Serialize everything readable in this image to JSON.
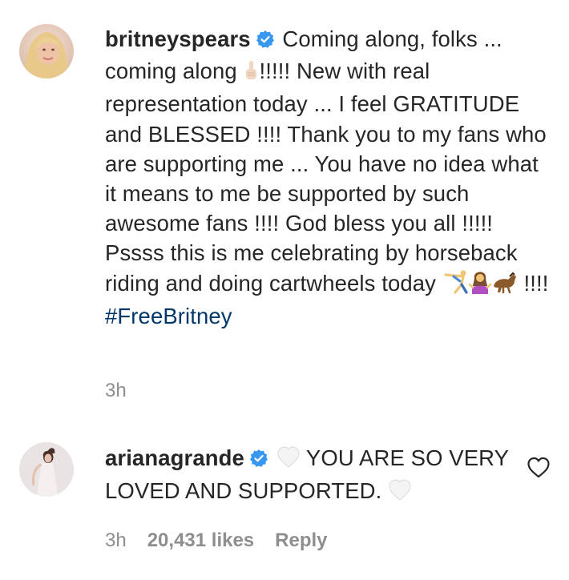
{
  "comments": [
    {
      "username": "britneyspears",
      "verified": true,
      "avatar_icon": "profile-photo",
      "text_part1": "Coming along, folks ... coming along",
      "emoji1": "raised-finger-emoji",
      "text_part2": "!!!!! New with real representation today ... I feel GRATITUDE and BLESSED !!!! Thank you to my fans who are supporting me ... You have no idea what it means to me be supported by such awesome fans !!!! God bless you all !!!!! Pssss this is me celebrating by horseback riding and doing cartwheels today",
      "emoji_group": [
        "cartwheel-emoji",
        "woman-shrugging-emoji",
        "horse-emoji"
      ],
      "text_part3": "!!!!",
      "hashtag": "#FreeBritney",
      "time": "3h"
    },
    {
      "username": "arianagrande",
      "verified": true,
      "avatar_icon": "profile-photo",
      "heart_emoji": "white-heart-emoji",
      "text": "YOU ARE SO VERY LOVED AND SUPPORTED.",
      "time": "3h",
      "likes": "20,431 likes",
      "reply": "Reply",
      "like_icon": "heart-outline-icon"
    }
  ],
  "colors": {
    "text": "#262626",
    "muted": "#8e8e8e",
    "hashtag": "#00376b",
    "verified": "#3897f0"
  }
}
